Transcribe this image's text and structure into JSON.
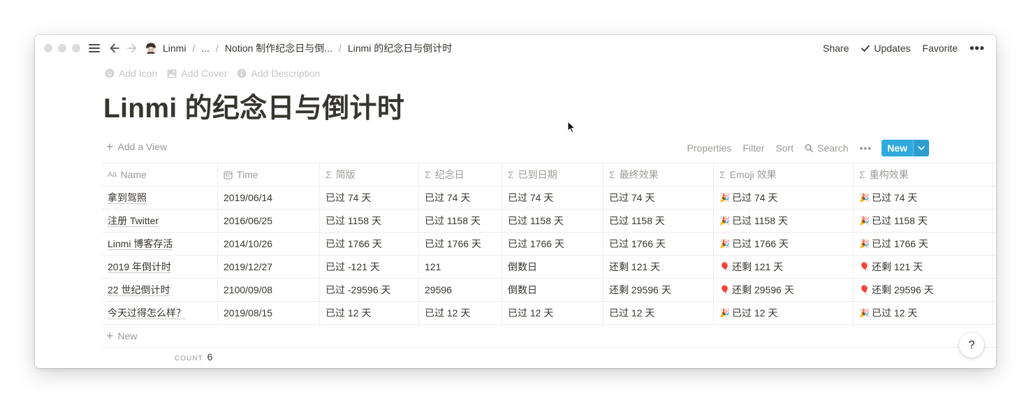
{
  "breadcrumb": [
    "Linmi",
    "...",
    "Notion 制作纪念日与倒...",
    "Linmi 的纪念日与倒计时"
  ],
  "top_actions": {
    "share": "Share",
    "updates": "Updates",
    "favorite": "Favorite"
  },
  "page_controls": {
    "add_icon": "Add Icon",
    "add_cover": "Add Cover",
    "add_description": "Add Description"
  },
  "page": {
    "title": "Linmi 的纪念日与倒计时"
  },
  "view_bar": {
    "add_view": "Add a View",
    "properties": "Properties",
    "filter": "Filter",
    "sort": "Sort",
    "search": "Search",
    "new": "New"
  },
  "table": {
    "columns": [
      {
        "label": "Name",
        "icon": "text-icon"
      },
      {
        "label": "Time",
        "icon": "calendar-icon"
      },
      {
        "label": "简版",
        "icon": "sigma-icon"
      },
      {
        "label": "纪念日",
        "icon": "sigma-icon"
      },
      {
        "label": "已到日期",
        "icon": "sigma-icon"
      },
      {
        "label": "最终效果",
        "icon": "sigma-icon"
      },
      {
        "label": "Emoji 效果",
        "icon": "sigma-icon"
      },
      {
        "label": "重构效果",
        "icon": "sigma-icon"
      }
    ],
    "rows": [
      {
        "name": "拿到驾照",
        "time": "2019/06/14",
        "simple": "已过 74 天",
        "anniversary": "已过 74 天",
        "reached": "已过 74 天",
        "final": "已过 74 天",
        "emoji": "🎉",
        "emoji_effect": "已过 74 天",
        "rebuild_emoji": "🎉",
        "rebuild": "已过 74 天"
      },
      {
        "name": "注册 Twitter",
        "time": "2016/06/25",
        "simple": "已过 1158 天",
        "anniversary": "已过 1158 天",
        "reached": "已过 1158 天",
        "final": "已过 1158 天",
        "emoji": "🎉",
        "emoji_effect": "已过 1158 天",
        "rebuild_emoji": "🎉",
        "rebuild": "已过 1158 天"
      },
      {
        "name": "Linmi 博客存活",
        "time": "2014/10/26",
        "simple": "已过 1766 天",
        "anniversary": "已过 1766 天",
        "reached": "已过 1766 天",
        "final": "已过 1766 天",
        "emoji": "🎉",
        "emoji_effect": "已过 1766 天",
        "rebuild_emoji": "🎉",
        "rebuild": "已过 1766 天"
      },
      {
        "name": "2019 年倒计时",
        "time": "2019/12/27",
        "simple": "已过 -121 天",
        "anniversary": "121",
        "reached": "倒数日",
        "final": "还剩 121 天",
        "emoji": "🎈",
        "emoji_effect": "还剩 121 天",
        "rebuild_emoji": "🎈",
        "rebuild": "还剩 121 天"
      },
      {
        "name": "22 世纪倒计时",
        "time": "2100/09/08",
        "simple": "已过 -29596 天",
        "anniversary": "29596",
        "reached": "倒数日",
        "final": "还剩 29596 天",
        "emoji": "🎈",
        "emoji_effect": "还剩 29596 天",
        "rebuild_emoji": "🎈",
        "rebuild": "还剩 29596 天"
      },
      {
        "name": "今天过得怎么样？",
        "time": "2019/08/15",
        "simple": "已过 12 天",
        "anniversary": "已过 12 天",
        "reached": "已过 12 天",
        "final": "已过 12 天",
        "emoji": "🎉",
        "emoji_effect": "已过 12 天",
        "rebuild_emoji": "🎉",
        "rebuild": "已过 12 天"
      }
    ],
    "add_row": "New"
  },
  "footer": {
    "count_label": "COUNT",
    "count_value": "6"
  },
  "help": {
    "label": "?"
  },
  "colors": {
    "accent": "#2eaadc",
    "text": "#37352f",
    "muted": "#9b9a97",
    "border": "#ededec"
  }
}
